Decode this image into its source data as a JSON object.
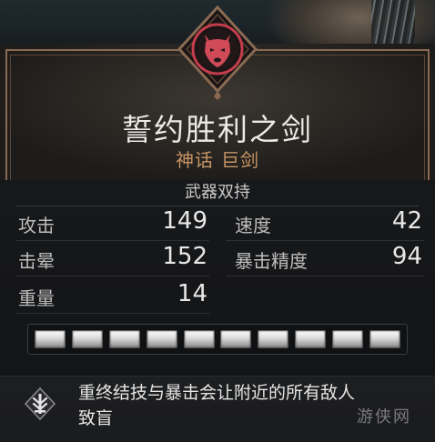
{
  "weapon": {
    "name": "誓约胜利之剑",
    "rarity": "神话",
    "type": "巨剑",
    "emblem_icon": "wolf-head-icon"
  },
  "stats": {
    "section_title": "武器双持",
    "left": [
      {
        "label": "攻击",
        "value": "149"
      },
      {
        "label": "击晕",
        "value": "152"
      },
      {
        "label": "重量",
        "value": "14"
      }
    ],
    "right": [
      {
        "label": "速度",
        "value": "42"
      },
      {
        "label": "暴击精度",
        "value": "94"
      }
    ]
  },
  "upgrade_slots": {
    "filled": 10,
    "total": 10
  },
  "perk": {
    "icon": "sword-ability-icon",
    "description_line1": "重终结技与暴击会让附近的所有敌人",
    "description_line2": "致盲"
  },
  "watermark": "游侠网",
  "colors": {
    "title": "#eceae6",
    "rarity": "#c79566",
    "emblem": "#c43d4c",
    "border": "#8a6a52"
  }
}
